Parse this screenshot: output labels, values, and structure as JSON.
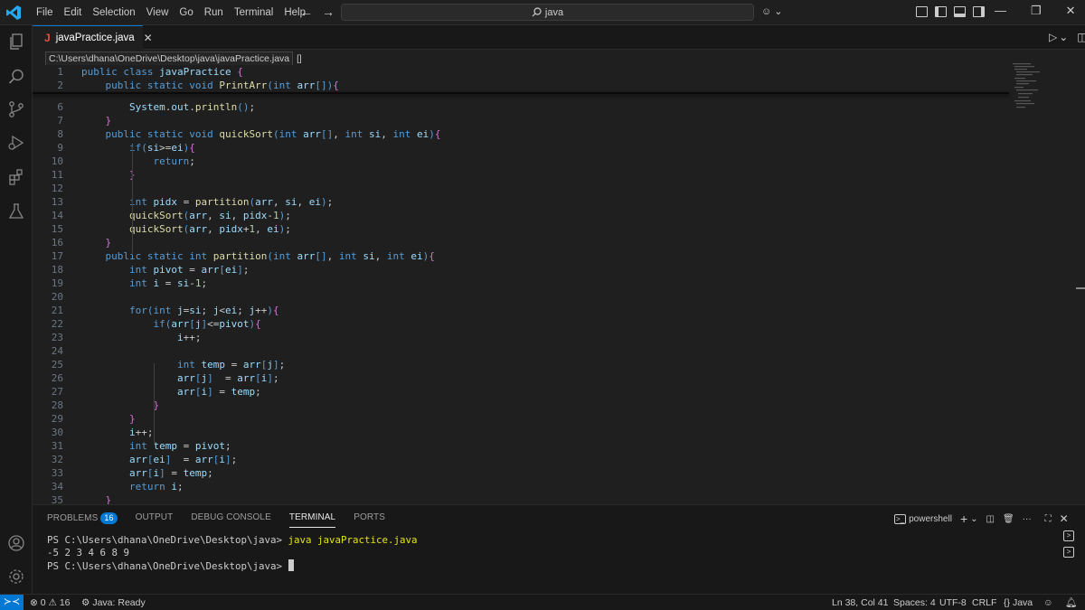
{
  "menu": [
    "File",
    "Edit",
    "Selection",
    "View",
    "Go",
    "Run",
    "Terminal",
    "Help"
  ],
  "search": {
    "value": "java"
  },
  "tab": {
    "icon_letter": "J",
    "label": "javaPractice.java",
    "close": "✕"
  },
  "breadcrumb": {
    "path": "C:\\Users\\dhana\\OneDrive\\Desktop\\java\\javaPractice.java",
    "symbol": "[]"
  },
  "editor": {
    "lines": [
      {
        "n": "1",
        "t": "public class javaPractice {"
      },
      {
        "n": "2",
        "t": "    public static void PrintArr(int arr[]){"
      },
      {
        "n": "6",
        "t": "        System.out.println();"
      },
      {
        "n": "7",
        "t": "    }"
      },
      {
        "n": "8",
        "t": "    public static void quickSort(int arr[], int si, int ei){"
      },
      {
        "n": "9",
        "t": "        if(si>=ei){"
      },
      {
        "n": "10",
        "t": "            return;"
      },
      {
        "n": "11",
        "t": "        }"
      },
      {
        "n": "12",
        "t": ""
      },
      {
        "n": "13",
        "t": "        int pidx = partition(arr, si, ei);"
      },
      {
        "n": "14",
        "t": "        quickSort(arr, si, pidx-1);"
      },
      {
        "n": "15",
        "t": "        quickSort(arr, pidx+1, ei);"
      },
      {
        "n": "16",
        "t": "    }"
      },
      {
        "n": "17",
        "t": "    public static int partition(int arr[], int si, int ei){"
      },
      {
        "n": "18",
        "t": "        int pivot = arr[ei];"
      },
      {
        "n": "19",
        "t": "        int i = si-1;"
      },
      {
        "n": "20",
        "t": ""
      },
      {
        "n": "21",
        "t": "        for(int j=si; j<ei; j++){"
      },
      {
        "n": "22",
        "t": "            if(arr[j]<=pivot){"
      },
      {
        "n": "23",
        "t": "                i++;"
      },
      {
        "n": "24",
        "t": ""
      },
      {
        "n": "25",
        "t": "                int temp = arr[j];"
      },
      {
        "n": "26",
        "t": "                arr[j]  = arr[i];"
      },
      {
        "n": "27",
        "t": "                arr[i] = temp;"
      },
      {
        "n": "28",
        "t": "            }"
      },
      {
        "n": "29",
        "t": "        }"
      },
      {
        "n": "30",
        "t": "        i++;"
      },
      {
        "n": "31",
        "t": "        int temp = pivot;"
      },
      {
        "n": "32",
        "t": "        arr[ei]  = arr[i];"
      },
      {
        "n": "33",
        "t": "        arr[i] = temp;"
      },
      {
        "n": "34",
        "t": "        return i;"
      },
      {
        "n": "35",
        "t": "    }"
      }
    ]
  },
  "panel": {
    "tabs": [
      "PROBLEMS",
      "OUTPUT",
      "DEBUG CONSOLE",
      "TERMINAL",
      "PORTS"
    ],
    "problems_count": "16",
    "shell": "powershell",
    "terminal": {
      "prompt1": "PS C:\\Users\\dhana\\OneDrive\\Desktop\\java>",
      "cmd": "java javaPractice.java",
      "output": "-5 2 3 4 6 8 9",
      "prompt2": "PS C:\\Users\\dhana\\OneDrive\\Desktop\\java>"
    }
  },
  "status": {
    "errors": "0",
    "warnings": "16",
    "java": "Java: Ready",
    "position": "Ln 38, Col 41",
    "spaces": "Spaces: 4",
    "encoding": "UTF-8",
    "eol": "CRLF",
    "language": "Java"
  },
  "colors": {
    "accent": "#0078d4",
    "background": "#1f1f1f",
    "keyword": "#569cd6",
    "function": "#dcdcaa",
    "variable": "#9cdcfe"
  }
}
